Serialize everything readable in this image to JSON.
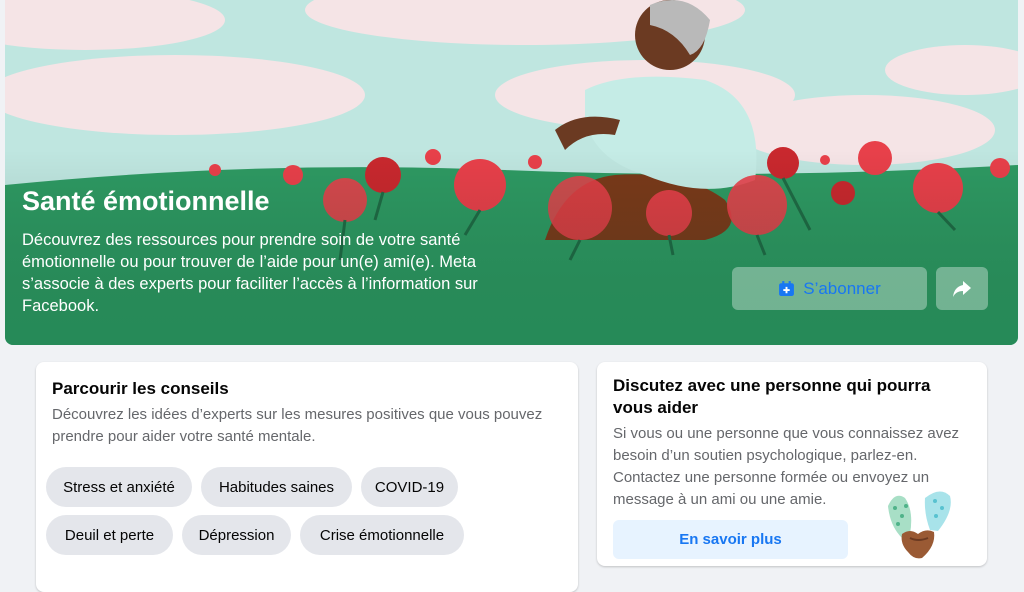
{
  "hero": {
    "title": "Santé émotionnelle",
    "description": "Découvrez des ressources pour prendre soin de votre santé émotionnelle ou pour trouver de l’aide pour un(e) ami(e). Meta s’associe à des experts pour faciliter l’accès à l’information sur Facebook.",
    "subscribe_label": "S’abonner",
    "subscribe_icon": "subscribe-icon",
    "share_icon": "share-icon"
  },
  "browse": {
    "title": "Parcourir les conseils",
    "subtitle": "Découvrez les idées d’experts sur les mesures positives que vous pouvez prendre pour aider votre santé mentale.",
    "chips": [
      "Stress et anxiété",
      "Habitudes saines",
      "COVID-19",
      "Deuil et perte",
      "Dépression",
      "Crise émotionnelle"
    ]
  },
  "help": {
    "title": "Discutez avec une personne qui pourra vous aider",
    "text": "Si vous ou une personne que vous connaissez avez besoin d’un soutien psychologique, parlez-en. Contactez une personne formée ou envoyez un message à un ami ou une amie.",
    "button_label": "En savoir plus"
  },
  "colors": {
    "accent": "#1877f2",
    "meadow": "#2e9a63",
    "sky": "#bfe6e0",
    "poppy": "#e8404a"
  }
}
